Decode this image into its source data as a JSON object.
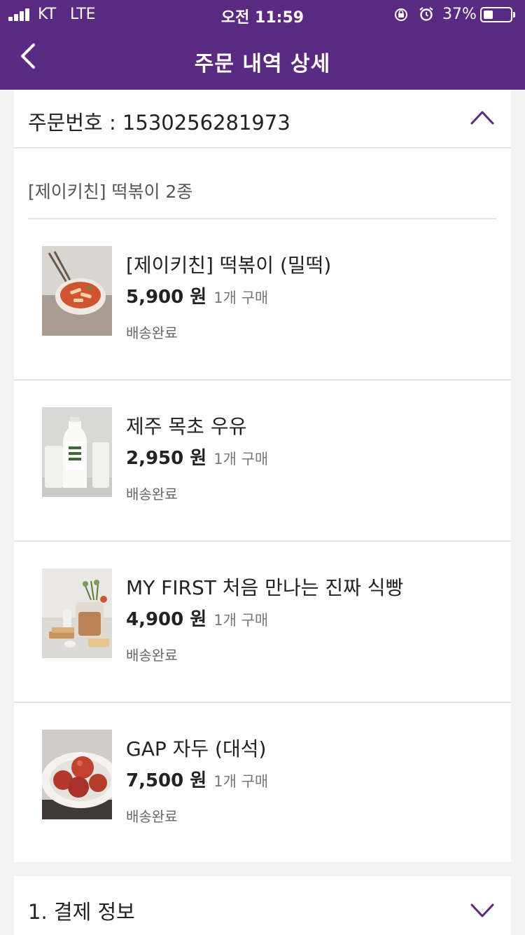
{
  "status_bar": {
    "carrier": "KT",
    "network": "LTE",
    "time": "오전 11:59",
    "battery": "37%",
    "battery_level": 0.37
  },
  "header": {
    "title": "주문 내역 상세",
    "back_icon": "chevron-left-icon"
  },
  "order": {
    "number_label": "주문번호 : 1530256281973",
    "group_title": "[제이키친] 떡볶이 2종",
    "items": [
      {
        "name": "[제이키친] 떡볶이 (밀떡)",
        "price": "5,900 원",
        "qty": "1개 구매",
        "status": "배송완료"
      },
      {
        "name": "제주 목초 우유",
        "price": "2,950 원",
        "qty": "1개 구매",
        "status": "배송완료"
      },
      {
        "name": "MY FIRST 처음 만나는 진짜 식빵",
        "price": "4,900 원",
        "qty": "1개 구매",
        "status": "배송완료"
      },
      {
        "name": "GAP 자두 (대석)",
        "price": "7,500 원",
        "qty": "1개 구매",
        "status": "배송완료"
      }
    ]
  },
  "payment": {
    "title": "1. 결제 정보"
  },
  "colors": {
    "brand_purple": "#5a2a82",
    "divider": "#e3e3e3",
    "background": "#f2f2f2"
  }
}
